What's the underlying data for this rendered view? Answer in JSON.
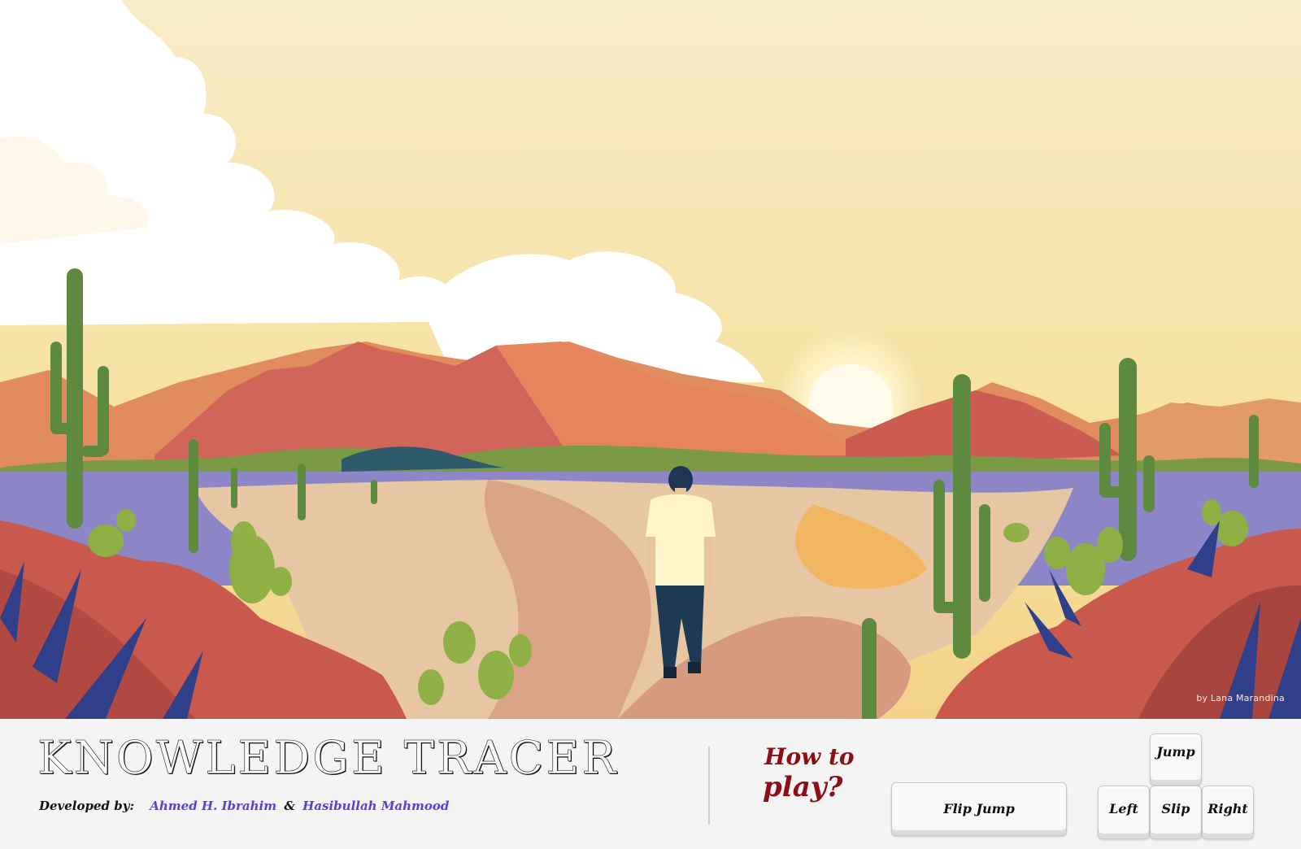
{
  "scene": {
    "credit": "by Lana Marandina",
    "sky_color": "#f7e6a6",
    "mountain_color": "#d2655a",
    "ground_color": "#e0b48c",
    "water_color": "#8e87c7",
    "cactus_color": "#5d8a3e"
  },
  "footer": {
    "title": "KNOWLEDGE TRACER",
    "developed_label": "Developed by:",
    "author1": "Ahmed H. Ibrahim",
    "ampersand": "&",
    "author2": "Hasibullah Mahmood",
    "howto_line1": "How to",
    "howto_line2": "play?"
  },
  "controls": {
    "flip_jump": "Flip Jump",
    "jump": "Jump",
    "left": "Left",
    "slip": "Slip",
    "right": "Right"
  },
  "colors": {
    "accent_author": "#5b3fd6",
    "howto": "#8b0f14",
    "panel_bg": "#f4f4f4"
  }
}
